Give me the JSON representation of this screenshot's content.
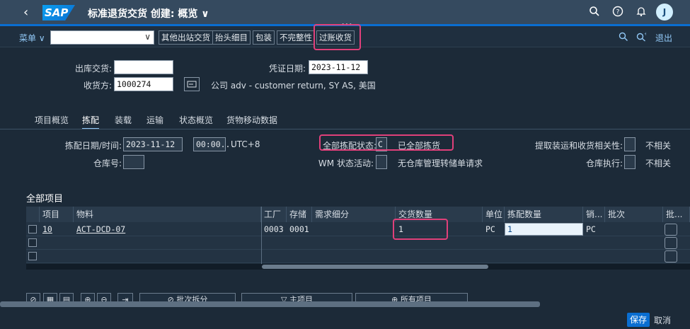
{
  "shell": {
    "logo": "SAP",
    "title": "标准退货交货 创建: 概览",
    "title_chevron": "∨",
    "avatar": "J"
  },
  "toolbar": {
    "menu": "菜单",
    "buttons": [
      "其他出站交货",
      "抬头细目",
      "包装",
      "不完整性",
      "过账收货"
    ],
    "exit": "退出"
  },
  "header": {
    "outbound_label": "出库交货:",
    "outbound_value": "",
    "doc_date_label": "凭证日期:",
    "doc_date_value": "2023-11-12",
    "ship_to_label": "收货方:",
    "ship_to_value": "1000274",
    "ship_to_desc": "公司 adv - customer return, SY AS, 美国"
  },
  "tabs": [
    "项目概览",
    "拣配",
    "装载",
    "运输",
    "状态概览",
    "货物移动数据"
  ],
  "picking": {
    "pick_dt_label": "拣配日期/时间:",
    "pick_date": "2023-11-12",
    "pick_time": "00:00...",
    "timezone": "UTC+8",
    "overall_status_label": "全部拣配状态:",
    "overall_status_code": "C",
    "overall_status_text": "已全部拣货",
    "extract_label": "提取装运和收货相关性:",
    "extract_value": "不相关",
    "warehouse_label": "仓库号:",
    "wm_label": "WM 状态活动:",
    "wm_text": "无仓库管理转储单请求",
    "wh_exec_label": "仓库执行:",
    "wh_exec_value": "不相关"
  },
  "items": {
    "section_title": "全部项目",
    "columns": [
      "项目",
      "物料",
      "工厂",
      "存储",
      "需求细分",
      "交货数量",
      "单位",
      "拣配数量",
      "销...",
      "批次",
      "批..."
    ],
    "rows": [
      {
        "item": "10",
        "material": "ACT-DCD-07",
        "plant": "0003",
        "storage": "0001",
        "req": "",
        "qty": "1",
        "unit": "PC",
        "pick_qty": "1",
        "sales_unit": "PC",
        "batch": ""
      }
    ]
  },
  "bottom": {
    "batch_split": "批次拆分",
    "main_items": "主项目",
    "all_items": "所有项目",
    "save": "保存",
    "cancel": "取消"
  }
}
